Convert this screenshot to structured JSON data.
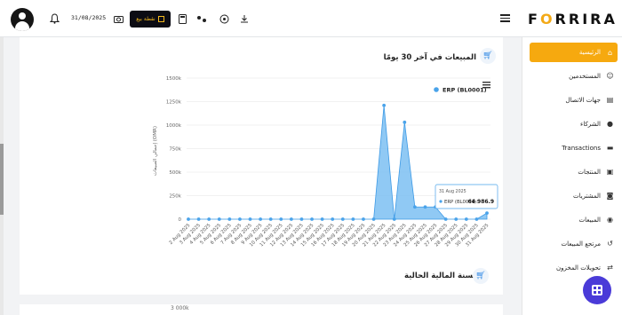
{
  "topbar": {
    "date": "31/08/2025",
    "pos_label": "نقطة بيع",
    "brand_prefix": "F",
    "brand_o": "O",
    "brand_suffix": "RRIRA"
  },
  "sidebar": {
    "items": [
      {
        "label": "الرئيسية",
        "icon": "home-icon",
        "glyph": "⌂",
        "active": true
      },
      {
        "label": "المستخدمين",
        "icon": "users-icon",
        "glyph": "☺",
        "active": false
      },
      {
        "label": "جهات الاتصال",
        "icon": "contacts-icon",
        "glyph": "▤",
        "active": false
      },
      {
        "label": "الشركاء",
        "icon": "partner-icon",
        "glyph": "●",
        "active": false
      },
      {
        "label": "Transactions",
        "icon": "transactions-icon",
        "glyph": "▬",
        "active": false
      },
      {
        "label": "المنتجات",
        "icon": "products-icon",
        "glyph": "▣",
        "active": false
      },
      {
        "label": "المشتريات",
        "icon": "purchases-icon",
        "glyph": "◙",
        "active": false
      },
      {
        "label": "المبيعات",
        "icon": "sales-icon",
        "glyph": "◉",
        "active": false
      },
      {
        "label": "مرتجع المبيعات",
        "icon": "sales-return-icon",
        "glyph": "↺",
        "active": false
      },
      {
        "label": "تحويلات المخزون",
        "icon": "stock-transfer-icon",
        "glyph": "⇄",
        "active": false
      }
    ]
  },
  "card1": {
    "title": "المبيعات في آخر 30 يومًا"
  },
  "card2": {
    "title": "السنة المالية الحالية",
    "ytick_top": "3 000k"
  },
  "chart_data": {
    "type": "area",
    "title": "",
    "ylabel": "إجمالي المبيعات (OMR)",
    "xlabel": "",
    "ylim": [
      0,
      1500000
    ],
    "yticks": [
      "0",
      "250k",
      "500k",
      "750k",
      "1000k",
      "1250k",
      "1500k"
    ],
    "ytick_values": [
      0,
      250000,
      500000,
      750000,
      1000000,
      1250000,
      1500000
    ],
    "legend_position": "top-right",
    "x": [
      "2 Aug 2025",
      "3 Aug 2025",
      "4 Aug 2025",
      "5 Aug 2025",
      "6 Aug 2025",
      "7 Aug 2025",
      "8 Aug 2025",
      "9 Aug 2025",
      "10 Aug 2025",
      "11 Aug 2025",
      "12 Aug 2025",
      "13 Aug 2025",
      "14 Aug 2025",
      "15 Aug 2025",
      "16 Aug 2025",
      "17 Aug 2025",
      "18 Aug 2025",
      "19 Aug 2025",
      "20 Aug 2025",
      "21 Aug 2025",
      "22 Aug 2025",
      "23 Aug 2025",
      "24 Aug 2025",
      "25 Aug 2025",
      "26 Aug 2025",
      "27 Aug 2025",
      "28 Aug 2025",
      "29 Aug 2025",
      "30 Aug 2025",
      "31 Aug 2025"
    ],
    "series": [
      {
        "name": "ERP (BL0001)",
        "color": "#4aa3ea",
        "values": [
          0,
          0,
          0,
          0,
          0,
          0,
          0,
          0,
          0,
          0,
          0,
          0,
          0,
          0,
          0,
          0,
          0,
          0,
          0,
          1210000,
          0,
          1030000,
          130000,
          130000,
          130000,
          0,
          0,
          0,
          0,
          64986.9
        ]
      }
    ],
    "tooltip": {
      "date": "31 Aug 2025",
      "series": "ERP (BL0001)",
      "value": "64 986.9"
    }
  }
}
